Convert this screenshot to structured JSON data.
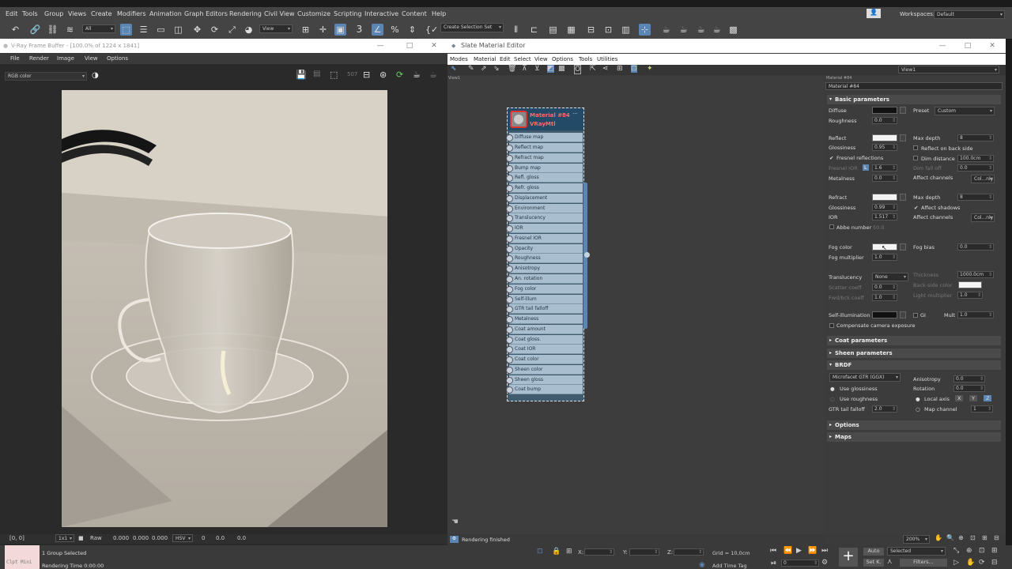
{
  "menubar": [
    "Edit",
    "Tools",
    "Group",
    "Views",
    "Create",
    "Modifiers",
    "Animation",
    "Graph Editors",
    "Rendering",
    "Civil View",
    "Customize",
    "Scripting",
    "Interactive",
    "Content",
    "Help"
  ],
  "workspaces_label": "Workspaces:",
  "workspace_value": "Default",
  "toolbar": {
    "filter": "All",
    "view": "View",
    "selection_set": "Create Selection Set"
  },
  "vfb": {
    "title": "V-Ray Frame Buffer - [100.0% of 1224 x 1841]",
    "menu": [
      "File",
      "Render",
      "Image",
      "View",
      "Options"
    ],
    "channel": "RGB color",
    "coords": "[0, 0]",
    "zoom": "1x1",
    "raw": "Raw",
    "v1": "0.000",
    "v2": "0.000",
    "v3": "0.000",
    "mode": "HSV",
    "h": "0",
    "s": "0.0",
    "v": "0.0"
  },
  "sme": {
    "title": "Slate Material Editor",
    "menu": [
      "Modes",
      "Material",
      "Edit",
      "Select",
      "View",
      "Options",
      "Tools",
      "Utilities"
    ],
    "view_tab": "View1",
    "view_label": "View1",
    "status": "Rendering finished",
    "zoom": "200%"
  },
  "node": {
    "name": "Material #84",
    "type": "VRayMtl",
    "slots": [
      "Diffuse map",
      "Reflect map",
      "Refract map",
      "Bump map",
      "Refl. gloss",
      "Refr. gloss",
      "Displacement",
      "Environment",
      "Translucency",
      "IOR",
      "Fresnel IOR",
      "Opacity",
      "Roughness",
      "Anisotropy",
      "An. rotation",
      "Fog color",
      "Self-illum",
      "GTR tail falloff",
      "Metalness",
      "Coat amount",
      "Coat gloss.",
      "Coat IOR",
      "Coat color",
      "Sheen color",
      "Sheen gloss",
      "Coat bump"
    ]
  },
  "panel": {
    "header": "Material #84",
    "material_field": "Material #84",
    "basic": "Basic parameters",
    "diffuse": "Diffuse",
    "preset": "Preset",
    "preset_val": "Custom",
    "roughness": "Roughness",
    "roughness_val": "0.0",
    "reflect": "Reflect",
    "maxdepth": "Max depth",
    "maxdepth_val": "8",
    "glossiness": "Glossiness",
    "gloss_val": "0.95",
    "reflect_back": "Reflect on back side",
    "fresnel": "Fresnel reflections",
    "dim_dist": "Dim distance",
    "dim_dist_val": "100.0cm",
    "fresnel_ior": "Fresnel IOR",
    "fresnel_ior_lock": "L",
    "fresnel_ior_val": "1.6",
    "dim_falloff": "Dim fall off",
    "dim_falloff_val": "0.0",
    "metalness": "Metalness",
    "metal_val": "0.0",
    "affect_ch": "Affect channels",
    "affect_val": "Col...nly",
    "refract": "Refract",
    "r_maxdepth": "Max depth",
    "r_maxdepth_val": "8",
    "r_gloss": "Glossiness",
    "r_gloss_val": "0.99",
    "affect_shadows": "Affect shadows",
    "ior": "IOR",
    "ior_val": "1.517",
    "r_affect": "Affect channels",
    "r_affect_val": "Col...nly",
    "abbe": "Abbe number",
    "abbe_val": "50.0",
    "fog_color": "Fog color",
    "fog_bias": "Fog bias",
    "fog_bias_val": "0.0",
    "fog_mult": "Fog multiplier",
    "fog_mult_val": "1.0",
    "translucency": "Translucency",
    "trans_val": "None",
    "thickness": "Thickness",
    "thickness_val": "1000.0cm",
    "scatter": "Scatter coeff",
    "scatter_val": "0.0",
    "backside": "Back-side color",
    "fwdbck": "Fwd/bck coeff",
    "fwdbck_val": "1.0",
    "lightmult": "Light multiplier",
    "lightmult_val": "1.0",
    "selfillum": "Self-illumination",
    "gi": "GI",
    "mult": "Mult",
    "mult_val": "1.0",
    "compensate": "Compensate camera exposure",
    "coat": "Coat parameters",
    "sheen": "Sheen parameters",
    "brdf": "BRDF",
    "brdf_type": "Microfacet GTR (GGX)",
    "anisotropy": "Anisotropy",
    "aniso_val": "0.0",
    "use_gloss": "Use glossiness",
    "rotation": "Rotation",
    "rot_val": "0.0",
    "use_rough": "Use roughness",
    "local_axis": "Local axis",
    "ax_x": "X",
    "ax_y": "Y",
    "ax_z": "Z",
    "gtr": "GTR tail falloff",
    "gtr_val": "2.0",
    "map_channel": "Map channel",
    "map_val": "1",
    "options": "Options",
    "maps": "Maps"
  },
  "status": {
    "left_thumb": "Clpt Mini",
    "group": "1 Group Selected",
    "rendering_time": "Rendering Time  0:00:00",
    "x": "X:",
    "y": "Y:",
    "z": "Z:",
    "grid": "Grid = 10,0cm",
    "add_time_tag": "Add Time Tag",
    "auto": "Auto",
    "selected": "Selected",
    "setk": "Set K.",
    "filters": "Filters...",
    "frame": "0"
  },
  "colors": {
    "accent": "#5b86b4",
    "node_header": "#234a66",
    "node_slot": "#a9bfcf"
  }
}
